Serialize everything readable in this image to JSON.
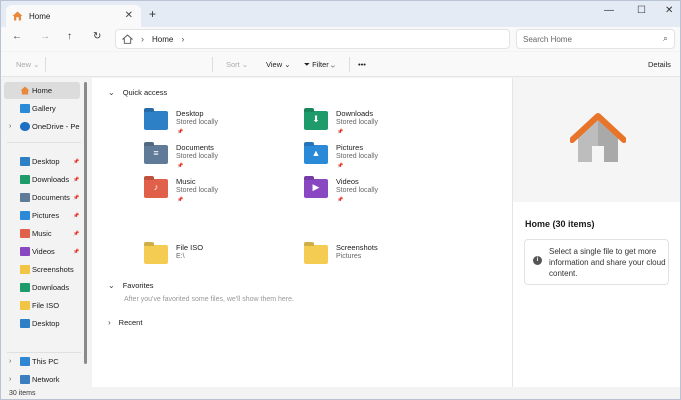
{
  "tab": {
    "title": "Home",
    "close": "✕",
    "new": "+"
  },
  "window": {
    "minimize": "—",
    "maximize": "☐",
    "close": "✕"
  },
  "address": {
    "crumb": "Home",
    "search_placeholder": "Search Home"
  },
  "commands": {
    "new": "New",
    "sort": "Sort",
    "view": "View",
    "filter": "Filter",
    "more": "•••",
    "details": "Details"
  },
  "sidebar": {
    "home": "Home",
    "gallery": "Gallery",
    "onedrive": "OneDrive - Personal",
    "pinned": [
      {
        "label": "Desktop",
        "color": "#2d7fc6"
      },
      {
        "label": "Downloads",
        "color": "#1e9b6a"
      },
      {
        "label": "Documents",
        "color": "#5f7b98"
      },
      {
        "label": "Pictures",
        "color": "#2b8ad8"
      },
      {
        "label": "Music",
        "color": "#e0604a"
      },
      {
        "label": "Videos",
        "color": "#8a47c2"
      }
    ],
    "recent": [
      {
        "label": "Screenshots",
        "color": "#f2c443"
      },
      {
        "label": "Downloads",
        "color": "#1e9b6a"
      },
      {
        "label": "File ISO",
        "color": "#f2c443"
      },
      {
        "label": "Desktop",
        "color": "#2d7fc6"
      }
    ],
    "thispc": "This PC",
    "network": "Network"
  },
  "main": {
    "quick_access": "Quick access",
    "favorites": "Favorites",
    "favorites_msg": "After you've favorited some files, we'll show them here.",
    "recent": "Recent",
    "items": [
      {
        "name": "Desktop",
        "sub": "Stored locally",
        "pin": true,
        "color": "#2d7fc6",
        "glyph": ""
      },
      {
        "name": "Downloads",
        "sub": "Stored locally",
        "pin": true,
        "color": "#1e9b6a",
        "glyph": "⬇"
      },
      {
        "name": "Documents",
        "sub": "Stored locally",
        "pin": true,
        "color": "#5f7b98",
        "glyph": "≡"
      },
      {
        "name": "Pictures",
        "sub": "Stored locally",
        "pin": true,
        "color": "#2b8ad8",
        "glyph": "▲"
      },
      {
        "name": "Music",
        "sub": "Stored locally",
        "pin": true,
        "color": "#e0604a",
        "glyph": "♪"
      },
      {
        "name": "Videos",
        "sub": "Stored locally",
        "pin": true,
        "color": "#8a47c2",
        "glyph": "▶"
      },
      {
        "name": "File ISO",
        "sub": "E:\\",
        "pin": false,
        "color": "#f5cc52",
        "glyph": ""
      },
      {
        "name": "Screenshots",
        "sub": "Pictures",
        "pin": false,
        "color": "#f5cc52",
        "glyph": ""
      }
    ]
  },
  "details": {
    "title": "Home (30 items)",
    "info": "Select a single file to get more information and share your cloud content.",
    "info_icon": "i"
  },
  "status": "30 items"
}
